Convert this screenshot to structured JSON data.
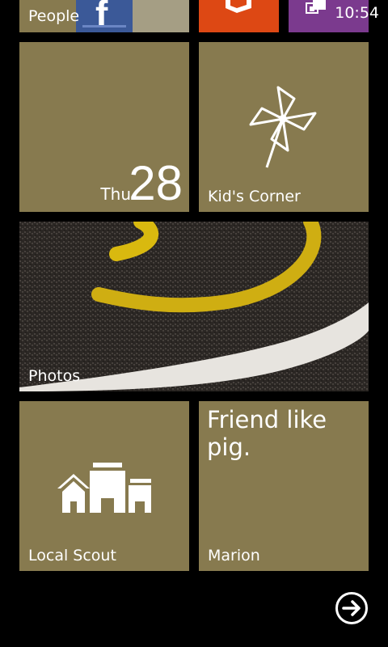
{
  "status_bar": {
    "time": "10:54"
  },
  "tiles": {
    "people": {
      "label": "People",
      "fb_letter": "f"
    },
    "calendar": {
      "day": "Thu",
      "date": "28"
    },
    "kids_corner": {
      "label": "Kid's Corner"
    },
    "photos": {
      "label": "Photos"
    },
    "local_scout": {
      "label": "Local Scout"
    },
    "marion": {
      "label": "Marion",
      "message": "Friend like pig."
    }
  },
  "colors": {
    "accent": "#877a4f",
    "office": "#dd4814",
    "photos_hub": "#7b3a8e",
    "facebook": "#3b5998"
  },
  "icons": {
    "office": "office-icon",
    "photos_hub": "camera-roll-icon",
    "kids": "pinwheel-icon",
    "scout": "buildings-icon",
    "arrow": "arrow-right-circle-icon"
  }
}
